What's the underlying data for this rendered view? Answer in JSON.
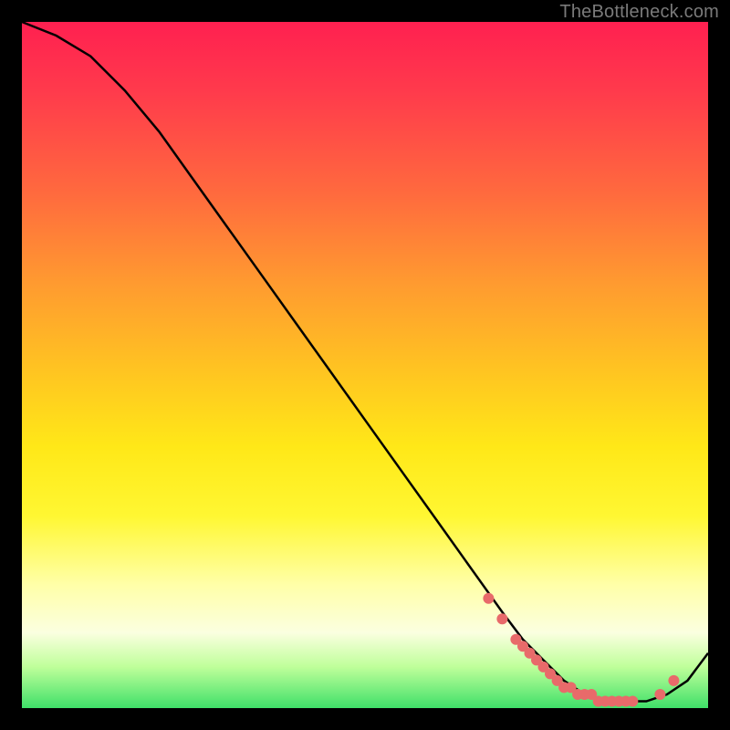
{
  "watermark": "TheBottleneck.com",
  "chart_data": {
    "type": "line",
    "title": "",
    "xlabel": "",
    "ylabel": "",
    "xlim": [
      0,
      100
    ],
    "ylim": [
      0,
      100
    ],
    "series": [
      {
        "name": "curve",
        "x": [
          0,
          5,
          10,
          15,
          20,
          25,
          30,
          35,
          40,
          45,
          50,
          55,
          60,
          65,
          70,
          73,
          76,
          79,
          82,
          85,
          88,
          91,
          94,
          97,
          100
        ],
        "y": [
          100,
          98,
          95,
          90,
          84,
          77,
          70,
          63,
          56,
          49,
          42,
          35,
          28,
          21,
          14,
          10,
          7,
          4,
          2,
          1,
          1,
          1,
          2,
          4,
          8
        ]
      }
    ],
    "highlight_points": {
      "name": "bottleneck-range",
      "color": "#e86a6a",
      "x": [
        68,
        70,
        72,
        73,
        74,
        75,
        76,
        77,
        78,
        79,
        80,
        81,
        82,
        83,
        84,
        85,
        86,
        87,
        88,
        89,
        93,
        95
      ],
      "y": [
        16,
        13,
        10,
        9,
        8,
        7,
        6,
        5,
        4,
        3,
        3,
        2,
        2,
        2,
        1,
        1,
        1,
        1,
        1,
        1,
        2,
        4
      ]
    },
    "gradient_stops": [
      {
        "pos": 0,
        "color": "#ff2050"
      },
      {
        "pos": 50,
        "color": "#ffd020"
      },
      {
        "pos": 85,
        "color": "#ffffc0"
      },
      {
        "pos": 100,
        "color": "#30d860"
      }
    ]
  }
}
